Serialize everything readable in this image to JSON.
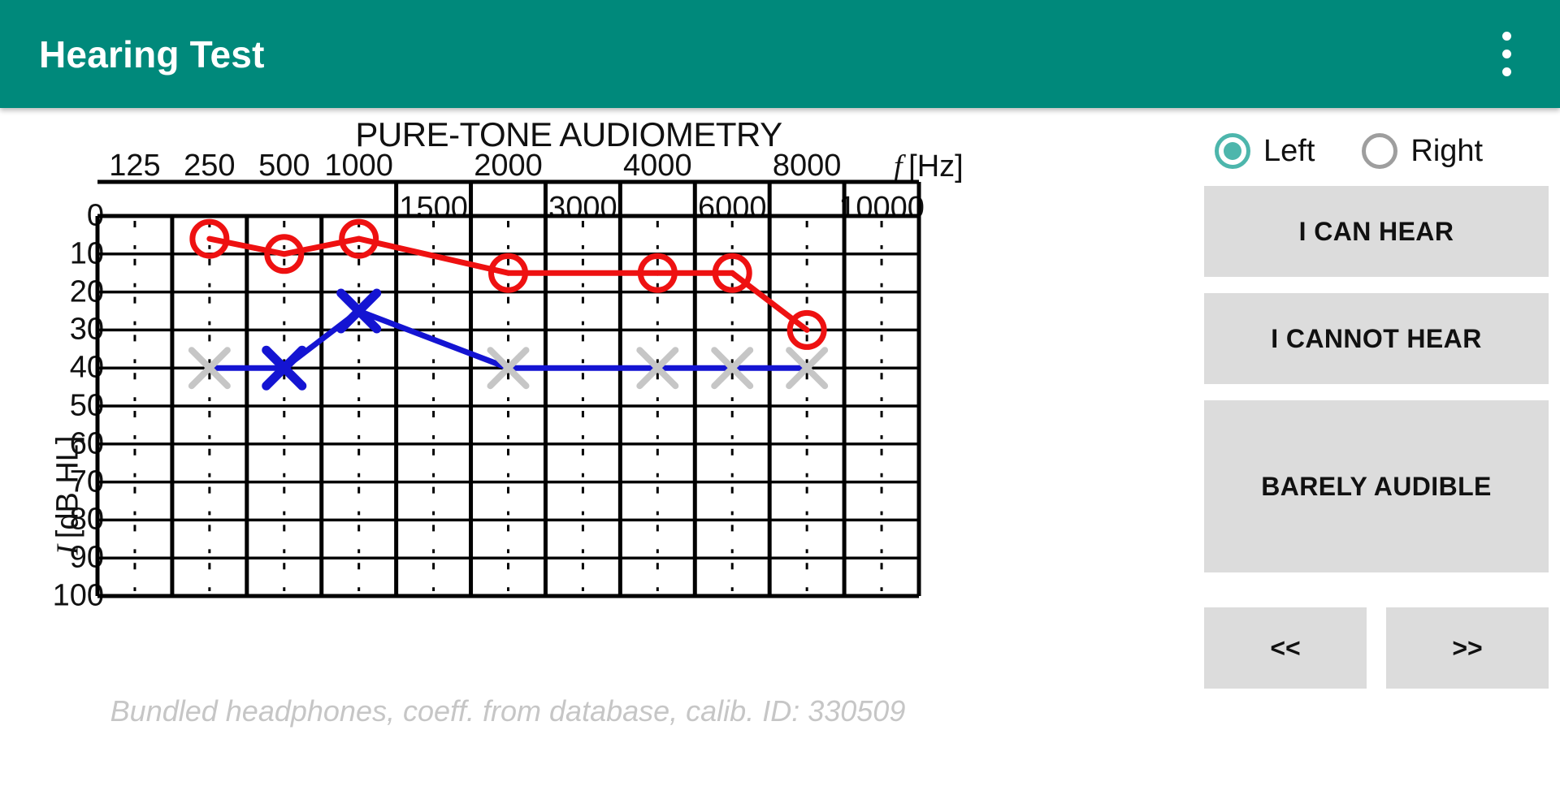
{
  "app": {
    "title": "Hearing Test",
    "accent_color": "#00897B",
    "menu_icon": "overflow-menu-icon"
  },
  "ear_selector": {
    "options": [
      {
        "label": "Left",
        "selected": true
      },
      {
        "label": "Right",
        "selected": false
      }
    ],
    "selected_color": "#4DB6AC",
    "unselected_color": "#9e9e9e"
  },
  "controls": {
    "can_hear": "I CAN HEAR",
    "cannot_hear": "I CANNOT HEAR",
    "barely_audible": "BARELY AUDIBLE",
    "prev": "<<",
    "next": ">>",
    "button_color": "#dcdcdc"
  },
  "caption": "Bundled headphones, coeff. from database, calib. ID: 330509",
  "chart_data": {
    "type": "line",
    "title": "PURE-TONE AUDIOMETRY",
    "xlabel": "f [Hz]",
    "ylabel": "I [dB HL]",
    "x_tick_labels_row1": [
      "125",
      "250",
      "500",
      "1000",
      "2000",
      "4000",
      "8000"
    ],
    "x_tick_labels_row2": [
      "1500",
      "3000",
      "6000",
      "10000"
    ],
    "frequencies": [
      125,
      250,
      500,
      1000,
      1500,
      2000,
      3000,
      4000,
      6000,
      8000,
      10000
    ],
    "y_tick_labels": [
      "0",
      "10",
      "20",
      "30",
      "40",
      "50",
      "60",
      "70",
      "80",
      "90",
      "100"
    ],
    "ylim": [
      0,
      100
    ],
    "grid": true,
    "legend_position": "none",
    "series": [
      {
        "name": "Right ear",
        "marker": "circle",
        "color": "#EE1111",
        "points": [
          {
            "freq": 250,
            "level": 6
          },
          {
            "freq": 500,
            "level": 10
          },
          {
            "freq": 1000,
            "level": 6
          },
          {
            "freq": 2000,
            "level": 15
          },
          {
            "freq": 4000,
            "level": 15
          },
          {
            "freq": 6000,
            "level": 15
          },
          {
            "freq": 8000,
            "level": 30
          }
        ]
      },
      {
        "name": "Left ear",
        "marker": "cross",
        "color": "#1414D2",
        "inactive_color": "#c6c6c6",
        "points": [
          {
            "freq": 250,
            "level": 40,
            "state": "inactive"
          },
          {
            "freq": 500,
            "level": 40,
            "state": "active"
          },
          {
            "freq": 1000,
            "level": 25,
            "state": "active"
          },
          {
            "freq": 2000,
            "level": 40,
            "state": "inactive"
          },
          {
            "freq": 4000,
            "level": 40,
            "state": "inactive"
          },
          {
            "freq": 6000,
            "level": 40,
            "state": "inactive"
          },
          {
            "freq": 8000,
            "level": 40,
            "state": "inactive"
          }
        ]
      }
    ]
  }
}
